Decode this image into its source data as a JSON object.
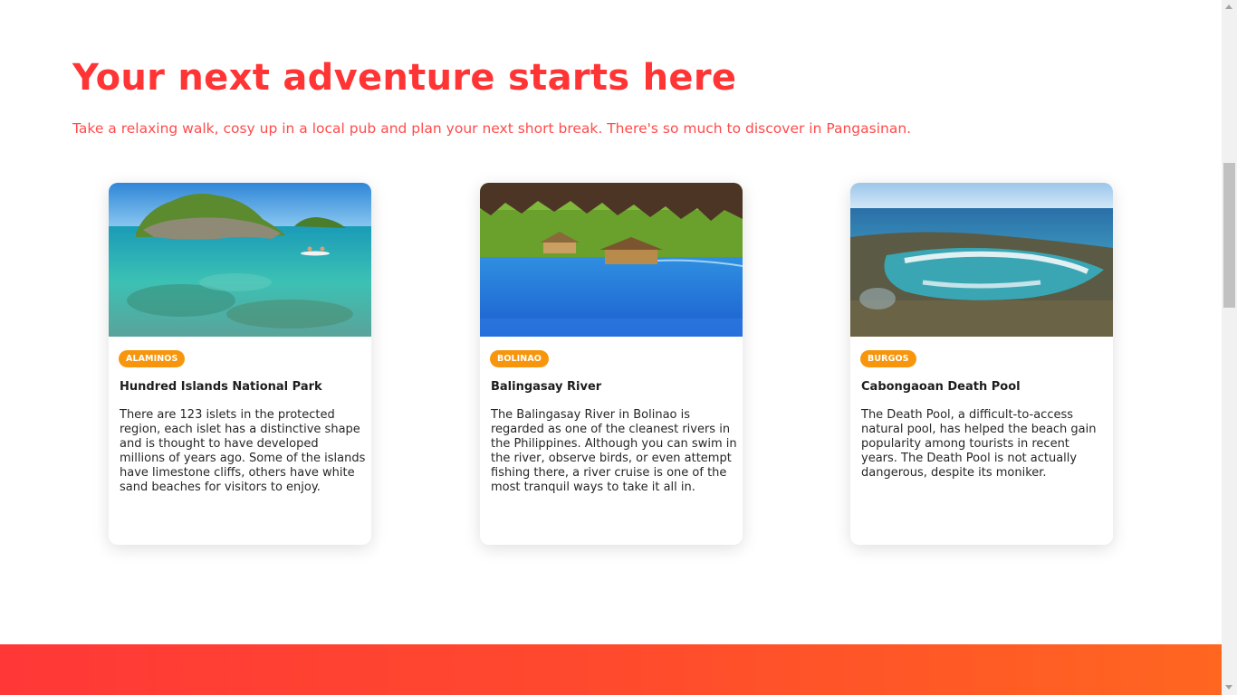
{
  "header": {
    "title": "Your next adventure starts here",
    "subtitle": "Take a relaxing walk, cosy up in a local pub and plan your next short break. There's so much to discover in Pangasinan."
  },
  "cards": [
    {
      "badge": "ALAMINOS",
      "title": "Hundred Islands National Park",
      "text": "There are 123 islets in the protected region, each islet has a distinctive shape and is thought to have developed millions of years ago. Some of the islands have limestone cliffs, others have white sand beaches for visitors to enjoy.",
      "image": "island-lagoon-photo"
    },
    {
      "badge": "BOLINAO",
      "title": "Balingasay River",
      "text": "The Balingasay River in Bolinao is regarded as one of the cleanest rivers in the Philippines. Although you can swim in the river, observe birds, or even attempt fishing there, a river cruise is one of the most tranquil ways to take it all in.",
      "image": "river-rafts-photo"
    },
    {
      "badge": "BURGOS",
      "title": "Cabongaoan Death Pool",
      "text": "The Death Pool, a difficult-to-access natural pool, has helped the beach gain popularity among tourists in recent years. The Death Pool is not actually dangerous, despite its moniker.",
      "image": "rock-pool-photo"
    }
  ],
  "colors": {
    "accent": "#ff3434",
    "badge": "#f7960d",
    "footer_gradient_start": "#ff3837",
    "footer_gradient_end": "#ff6620"
  }
}
